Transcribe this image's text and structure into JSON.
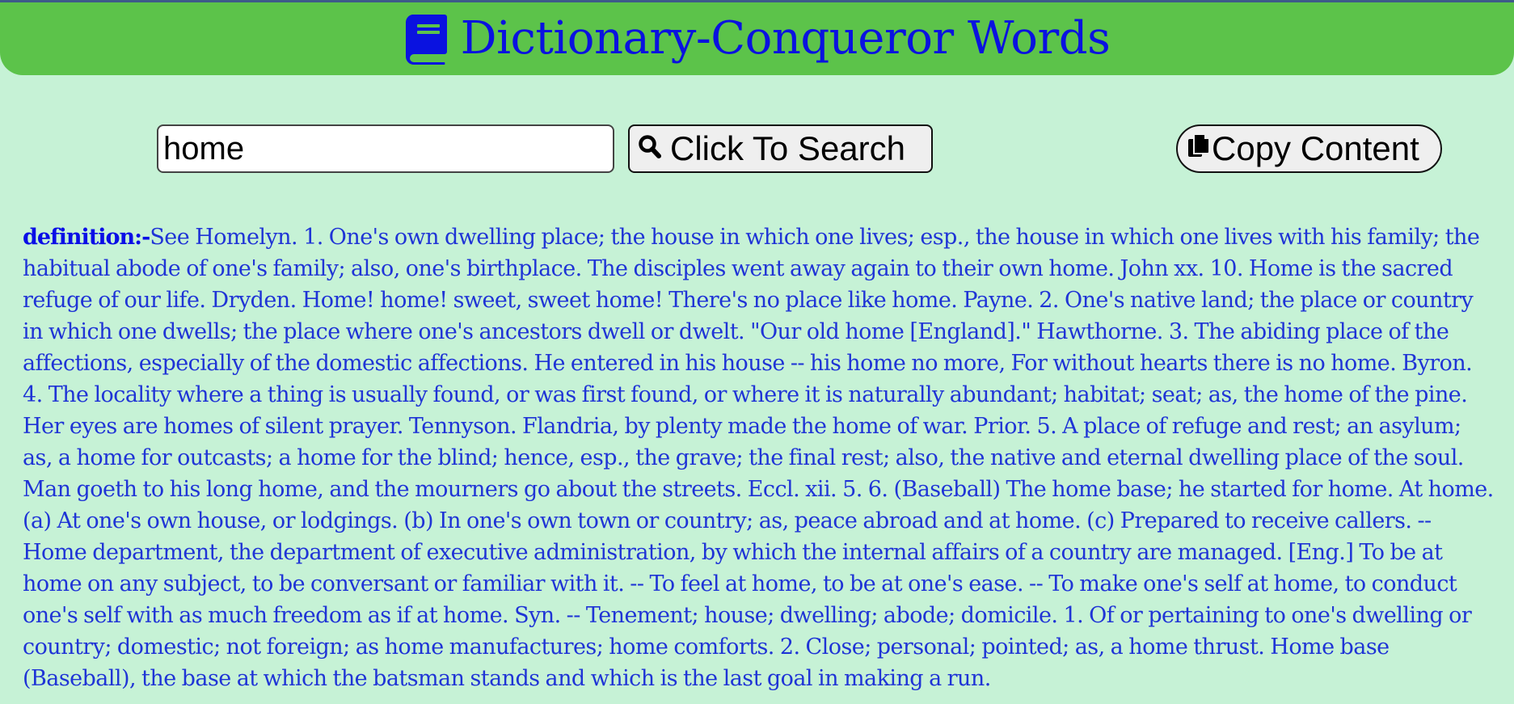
{
  "header": {
    "title": "Dictionary-Conqueror Words",
    "icon": "book-icon",
    "background_color": "#5cc34a",
    "title_color": "#0a12e0"
  },
  "search": {
    "input_value": "home",
    "search_button_label": "Click To Search",
    "search_icon": "search-icon",
    "copy_button_label": "Copy Content",
    "copy_icon": "copy-icon"
  },
  "result": {
    "label": "definition:-",
    "text": "See Homelyn. 1. One's own dwelling place; the house in which one lives; esp., the house in which one lives with his family; the habitual abode of one's family; also, one's birthplace. The disciples went away again to their own home. John xx. 10. Home is the sacred refuge of our life. Dryden. Home! home! sweet, sweet home! There's no place like home. Payne. 2. One's native land; the place or country in which one dwells; the place where one's ancestors dwell or dwelt. \"Our old home [England].\" Hawthorne. 3. The abiding place of the affections, especially of the domestic affections. He entered in his house -- his home no more, For without hearts there is no home. Byron. 4. The locality where a thing is usually found, or was first found, or where it is naturally abundant; habitat; seat; as, the home of the pine. Her eyes are homes of silent prayer. Tennyson. Flandria, by plenty made the home of war. Prior. 5. A place of refuge and rest; an asylum; as, a home for outcasts; a home for the blind; hence, esp., the grave; the final rest; also, the native and eternal dwelling place of the soul. Man goeth to his long home, and the mourners go about the streets. Eccl. xii. 5. 6. (Baseball) The home base; he started for home. At home.(a) At one's own house, or lodgings. (b) In one's own town or country; as, peace abroad and at home. (c) Prepared to receive callers. -- Home department, the department of executive administration, by which the internal affairs of a country are managed. [Eng.] To be at home on any subject, to be conversant or familiar with it. -- To feel at home, to be at one's ease. -- To make one's self at home, to conduct one's self with as much freedom as if at home. Syn. -- Tenement; house; dwelling; abode; domicile. 1. Of or pertaining to one's dwelling or country; domestic; not foreign; as home manufactures; home comforts. 2. Close; personal; pointed; as, a home thrust. Home base (Baseball), the base at which the batsman stands and which is the last goal in making a run.",
    "text_color": "#1f34d6"
  },
  "page": {
    "background_color": "#c6f2d6"
  }
}
